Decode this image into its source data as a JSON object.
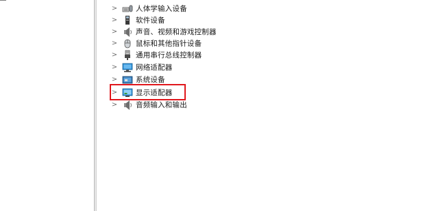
{
  "tree": {
    "items": [
      {
        "label": "人体学输入设备",
        "icon": "human-input-device-icon"
      },
      {
        "label": "软件设备",
        "icon": "software-device-icon"
      },
      {
        "label": "声音、视频和游戏控制器",
        "icon": "speaker-icon"
      },
      {
        "label": "鼠标和其他指针设备",
        "icon": "mouse-icon"
      },
      {
        "label": "通用串行总线控制器",
        "icon": "usb-icon"
      },
      {
        "label": "网络适配器",
        "icon": "network-adapter-icon"
      },
      {
        "label": "系统设备",
        "icon": "system-device-icon"
      },
      {
        "label": "显示适配器",
        "icon": "display-adapter-icon"
      },
      {
        "label": "音频输入和输出",
        "icon": "audio-io-icon"
      }
    ],
    "highlighted_index": 7,
    "highlight_color": "#e0161b"
  }
}
